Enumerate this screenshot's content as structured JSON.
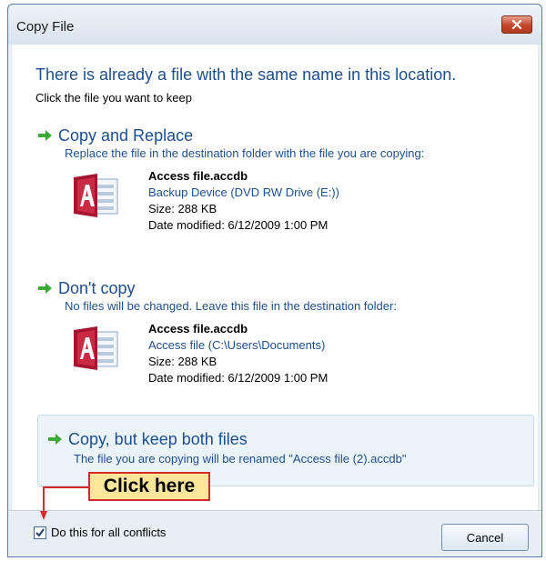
{
  "window": {
    "title": "Copy File"
  },
  "dialog": {
    "heading": "There is already a file with the same name in this location.",
    "subheading": "Click the file you want to keep"
  },
  "options": [
    {
      "title": "Copy and Replace",
      "description": "Replace the file in the destination folder with the file you are copying:",
      "file": {
        "name": "Access file.accdb",
        "location": "Backup Device (DVD RW Drive (E:))",
        "size": "Size: 288 KB",
        "modified": "Date modified: 6/12/2009 1:00 PM"
      }
    },
    {
      "title": "Don't copy",
      "description": "No files will be changed. Leave this file in the destination folder:",
      "file": {
        "name": "Access file.accdb",
        "location": "Access file (C:\\Users\\Documents)",
        "size": "Size: 288 KB",
        "modified": "Date modified: 6/12/2009 1:00 PM"
      }
    },
    {
      "title": "Copy, but keep both files",
      "description": "The file you are copying will be renamed \"Access file (2).accdb\""
    }
  ],
  "footer": {
    "checkbox_label": "Do this for all conflicts",
    "checkbox_checked": true,
    "cancel_label": "Cancel"
  },
  "callout": {
    "text": "Click here"
  },
  "colors": {
    "link_blue": "#1f4e8c",
    "arrow_green": "#3fa83a",
    "callout_border": "#d32b2b",
    "callout_fill": "#fde59a"
  }
}
